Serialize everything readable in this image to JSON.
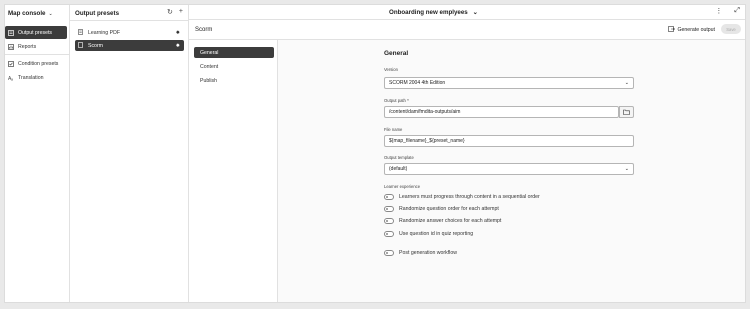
{
  "sidebar": {
    "title": "Map console",
    "items": [
      {
        "label": "Output presets",
        "icon": "presets-icon",
        "active": true
      },
      {
        "label": "Reports",
        "icon": "reports-icon",
        "active": false
      },
      {
        "label": "Condition presets",
        "icon": "condition-icon",
        "active": false
      },
      {
        "label": "Translation",
        "icon": "translation-icon",
        "active": false
      }
    ]
  },
  "presets": {
    "title": "Output presets",
    "items": [
      {
        "label": "Learning PDF",
        "active": false
      },
      {
        "label": "Scorm",
        "active": true
      }
    ]
  },
  "header": {
    "title": "Onboarding new emplyees"
  },
  "subheader": {
    "title": "Scorm",
    "generate_label": "Generate output",
    "save_label": "Save"
  },
  "tabs": [
    {
      "label": "General",
      "active": true
    },
    {
      "label": "Content",
      "active": false
    },
    {
      "label": "Publish",
      "active": false
    }
  ],
  "form": {
    "title": "General",
    "version": {
      "label": "Version",
      "value": "SCORM 2004 4th Edition"
    },
    "output_path": {
      "label": "Output path",
      "required_mark": "*",
      "value": "/content/dam/fmdita-outputs/aim"
    },
    "file_name": {
      "label": "File name",
      "value": "${map_filename}_${preset_name}"
    },
    "output_template": {
      "label": "Output template",
      "value": "(default)"
    },
    "learner_experience": {
      "label": "Learner experience"
    },
    "toggles": [
      {
        "label": "Learners must progress through content in a sequential order",
        "on": false
      },
      {
        "label": "Randomize question order for each attempt",
        "on": false
      },
      {
        "label": "Randomize answer choices for each attempt",
        "on": false
      },
      {
        "label": "Use question id in quiz reporting",
        "on": false
      }
    ],
    "post_generation": {
      "label": "Post generation workflow",
      "on": false
    }
  },
  "colors": {
    "active_bg": "#3c3c3c",
    "border": "#e1e1e1"
  }
}
